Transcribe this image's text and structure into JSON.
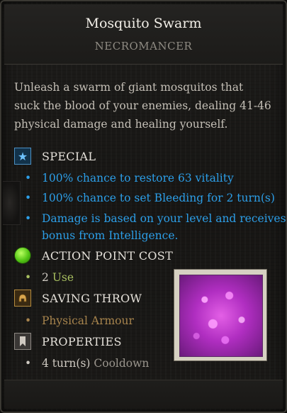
{
  "skill": {
    "name": "Mosquito Swarm",
    "school": "NECROMANCER",
    "description": "Unleash a swarm of giant mosquitos that suck the blood of your enemies, dealing 41-46 physical damage and healing yourself."
  },
  "special": {
    "label": "SPECIAL",
    "icon": "star-icon",
    "items": [
      "100% chance to restore 63 vitality",
      "100% chance to set Bleeding for 2 turn(s)",
      "Damage is based on your level and receives",
      "bonus from Intelligence."
    ]
  },
  "action_point_cost": {
    "label": "ACTION POINT COST",
    "icon": "green-orb-icon",
    "value": "2",
    "unit": "Use"
  },
  "saving_throw": {
    "label": "SAVING THROW",
    "icon": "helmet-icon",
    "value": "Physical Armour"
  },
  "properties": {
    "label": "PROPERTIES",
    "icon": "bookmark-icon",
    "value": "4 turn(s)",
    "unit": "Cooldown"
  },
  "skill_icon": "mosquito-swarm-icon",
  "colors": {
    "special_text": "#2c9ee7",
    "ap_text": "#a8bf60",
    "save_text": "#a7844d",
    "property_text": "#cfcac2"
  }
}
